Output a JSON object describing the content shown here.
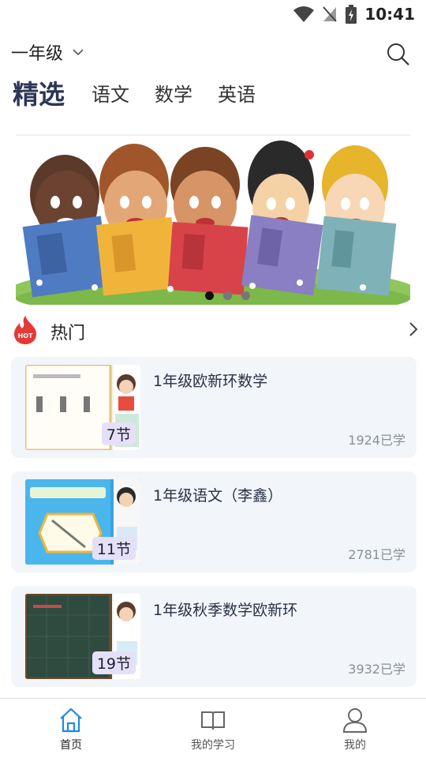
{
  "status_bar": {
    "time": "10:41"
  },
  "header": {
    "grade": "一年级"
  },
  "tabs": [
    {
      "label": "精选",
      "active": true
    },
    {
      "label": "语文",
      "active": false
    },
    {
      "label": "数学",
      "active": false
    },
    {
      "label": "英语",
      "active": false
    }
  ],
  "banner": {
    "slide_count": 3,
    "active_index": 0
  },
  "hot": {
    "title": "热门",
    "icon_text": "HOT"
  },
  "courses": [
    {
      "title": "1年级欧新环数学",
      "lessons": "7节",
      "learners": "1924已学"
    },
    {
      "title": "1年级语文（李鑫）",
      "lessons": "11节",
      "learners": "2781已学"
    },
    {
      "title": "1年级秋季数学欧新环",
      "lessons": "19节",
      "learners": "3932已学"
    }
  ],
  "bottom_nav": [
    {
      "label": "首页",
      "icon": "home-icon",
      "active": true
    },
    {
      "label": "我的学习",
      "icon": "book-icon",
      "active": false
    },
    {
      "label": "我的",
      "icon": "user-icon",
      "active": false
    }
  ],
  "colors": {
    "accent": "#1e88e5",
    "tab_active": "#2c3656",
    "card_bg": "#f2f5f9",
    "hot_red": "#e53935"
  }
}
